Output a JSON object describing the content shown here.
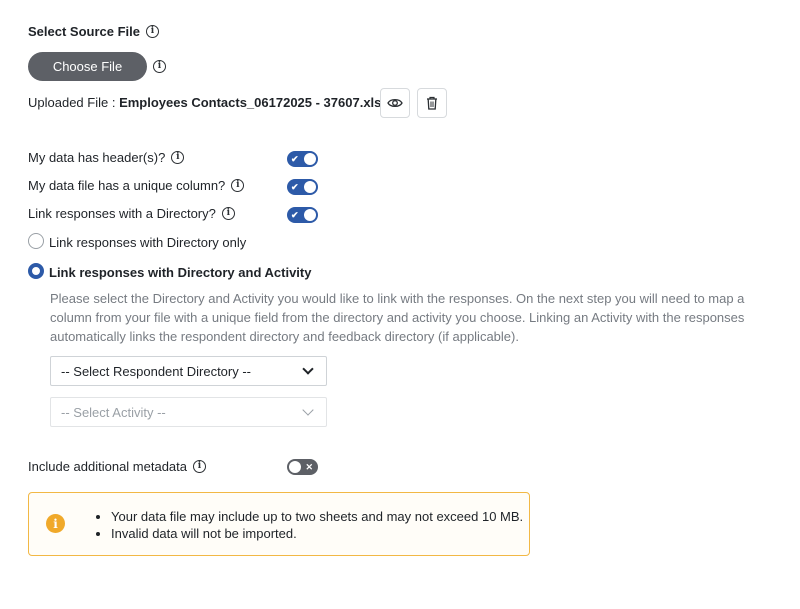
{
  "source": {
    "title": "Select Source File",
    "choose_label": "Choose File",
    "uploaded_prefix": "Uploaded File : ",
    "uploaded_name": "Employees Contacts_06172025 - 37607.xlsx"
  },
  "options": {
    "has_headers": {
      "label": "My data has header(s)?",
      "enabled": true
    },
    "unique_column": {
      "label": "My data file has a unique column?",
      "enabled": true
    },
    "link_directory": {
      "label": "Link responses with a Directory?",
      "enabled": true
    },
    "radio_directory_only": {
      "label": "Link responses with Directory only",
      "selected": false
    },
    "radio_directory_activity": {
      "label": "Link responses with Directory and Activity",
      "selected": true
    },
    "help_text": "Please select the Directory and Activity you would like to link with the responses. On the next step you will need to map a column from your file with a unique field from the directory and activity you choose.  Linking an Activity with the responses automatically links the respondent directory and feedback directory (if applicable).",
    "respondent_directory_select": "-- Select Respondent Directory --",
    "activity_select": "-- Select Activity --",
    "metadata": {
      "label": "Include additional metadata",
      "enabled": false
    }
  },
  "notice": {
    "items": [
      "Your data file may include up to two sheets and may not exceed 10 MB.",
      "Invalid data will not be imported."
    ]
  },
  "icons": {
    "info": "info-icon",
    "eye": "eye-icon",
    "trash": "trash-icon",
    "warning": "warning-info-icon",
    "chevron": "chevron-down-icon"
  },
  "colors": {
    "accent": "#2d5aa8",
    "button_dark": "#5d6066",
    "warning_border": "#f2b845",
    "warning_icon": "#f0a92a",
    "help_text": "#767b82"
  }
}
